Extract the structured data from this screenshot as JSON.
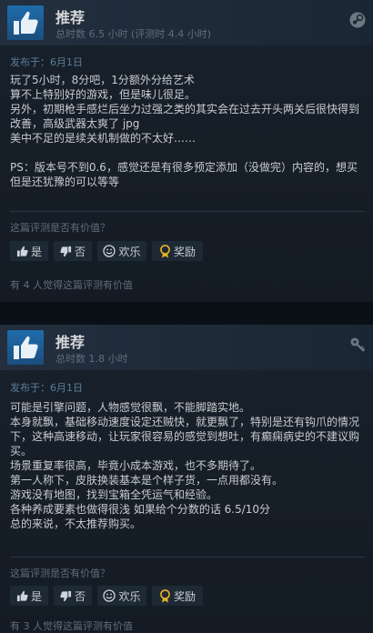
{
  "reviews": [
    {
      "recommendation": "推荐",
      "hours_text": "总时数 6.5 小时   (评测时 4.4 小时)",
      "posted": "发布于：6月1日",
      "body": "玩了5小时，8分吧，1分额外分给艺术\n算不上特别好的游戏，但是味儿很足。\n另外，初期枪手感烂后坐力过强之类的其实会在过去开头两关后很快得到改善，高级武器太爽了 jpg\n美中不足的是续关机制做的不太好……\n\nPS：版本号不到0.6，感觉还是有很多预定添加（没做完）内容的，想买但是还犹豫的可以等等",
      "helpful_question": "这篇评测是否有价值？",
      "buttons": {
        "yes": "是",
        "no": "否",
        "funny": "欢乐",
        "award": "奖励"
      },
      "helpful_count": "有 4 人觉得这篇评测有价值",
      "corner_icon": "steam-icon"
    },
    {
      "recommendation": "推荐",
      "hours_text": "总时数 1.8 小时",
      "posted": "发布于：6月1日",
      "body": "可能是引擎问题，人物感觉很飘，不能脚踏实地。\n本身就飘，基础移动速度设定还贼快，就更飘了，特别是还有钩爪的情况下，这种高速移动，让玩家很容易的感觉到想吐，有癫痫病史的不建议购买。\n场景重复率很高，毕竟小成本游戏，也不多期待了。\n第一人称下，皮肤换装基本是个样子货，一点用都没有。\n游戏没有地图，找到宝箱全凭运气和经验。\n各种养成要素也做得很浅 如果给个分数的话 6.5/10分\n总的来说，不太推荐购买。",
      "helpful_question": "这篇评测是否有价值？",
      "buttons": {
        "yes": "是",
        "no": "否",
        "funny": "欢乐",
        "award": "奖励"
      },
      "helpful_count": "有 3 人觉得这篇评测有价值",
      "corner_icon": "key-icon"
    }
  ],
  "colors": {
    "background": "#0e141b",
    "header": "#232f3e",
    "thumb_blue": "#1f6cab",
    "award_yellow": "#e5b41f",
    "posted_blue": "#5d7c97"
  }
}
